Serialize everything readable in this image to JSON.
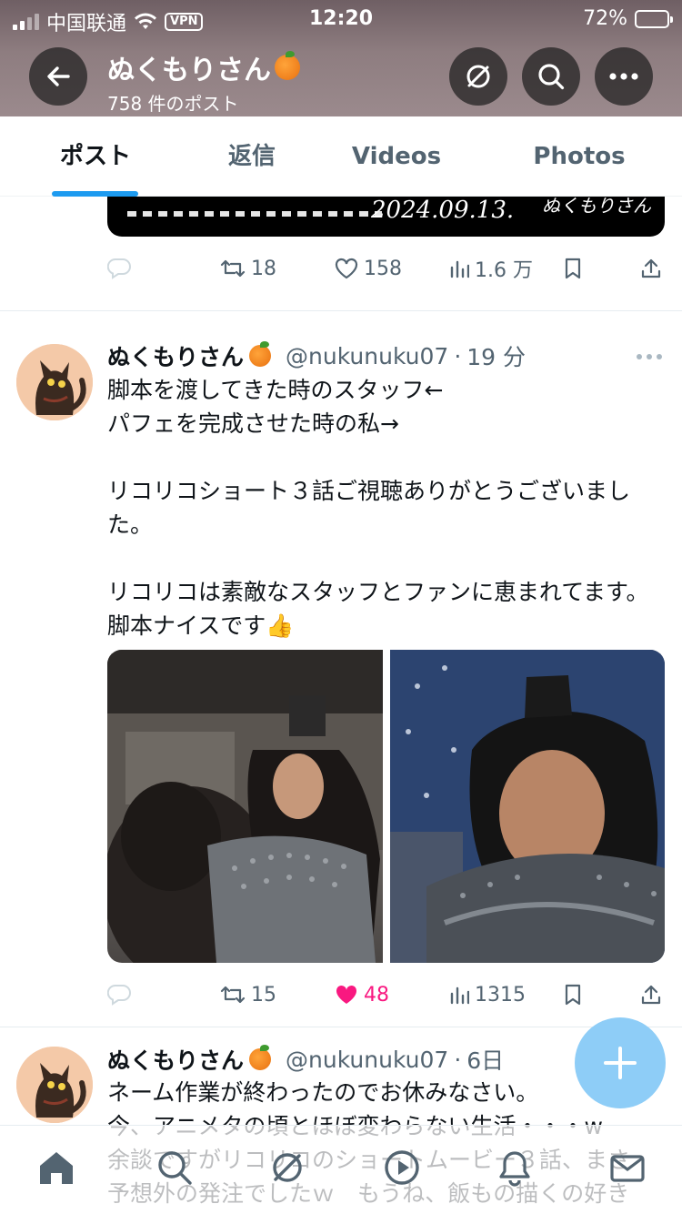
{
  "status_bar": {
    "carrier": "中国联通",
    "vpn": "VPN",
    "time": "12:20",
    "battery": "72%"
  },
  "header": {
    "name": "ぬくもりさん",
    "post_count": "758 件のポスト"
  },
  "tabs": [
    {
      "label": "ポスト"
    },
    {
      "label": "返信"
    },
    {
      "label": "Videos"
    },
    {
      "label": "Photos"
    }
  ],
  "prev_tweet": {
    "media_text": {
      "date": "2024.09.13.",
      "signature": "ぬくもりさん"
    },
    "actions": {
      "retweets": "18",
      "likes": "158",
      "views": "1.6 万"
    }
  },
  "tweets": [
    {
      "name": "ぬくもりさん",
      "handle": "@nukunuku07",
      "time": "19 分",
      "body": "脚本を渡してきた時のスタッフ←\nパフェを完成させた時の私→\n\nリコリコショート３話ご視聴ありがとうございました。\n\nリコリコは素敵なスタッフとファンに恵まれてます。脚本ナイスです👍",
      "actions": {
        "retweets": "15",
        "likes": "48",
        "views": "1315"
      }
    },
    {
      "name": "ぬくもりさん",
      "handle": "@nukunuku07",
      "time": "6日",
      "body": "ネーム作業が終わったのでお休みなさい。\n今、アニメタの頃とほぼ変わらない生活・・・w\n余談ですがリコリコのショートムービー３話、まさ\n予想外の発注でしたｗ　もうね、飯もの描くの好き"
    }
  ],
  "colors": {
    "accent": "#1d9bf0",
    "like": "#f91880",
    "fab": "#8ecdf7"
  }
}
